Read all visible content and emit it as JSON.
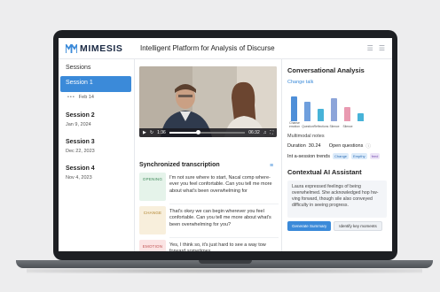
{
  "app": {
    "logo_text": "MIMESIS",
    "title": "Intelligent Platform for Analysis of Discurse"
  },
  "sidebar": {
    "title": "Sessions",
    "active_session": {
      "label": "Session 1",
      "date": "Feb 14"
    },
    "sessions": [
      {
        "label": "Session 2",
        "date": "Jan 9, 2024"
      },
      {
        "label": "Session 3",
        "date": "Dec 22, 2023"
      },
      {
        "label": "Session 4",
        "date": "Nov 4, 2023"
      }
    ]
  },
  "video": {
    "time_current": "1:36",
    "time_total": "06:32",
    "progress_fraction": 0.38
  },
  "transcription": {
    "title": "Synchronized transcription",
    "entries": [
      {
        "tag": "OPENING",
        "tag_bg": "#e5f3ea",
        "tag_color": "#3f8a5a",
        "text": "I'm not sure where to start, Nacal comp where- ever you feel confortable. Can you tell me more about what's been overwhelming for"
      },
      {
        "tag": "CHANGE",
        "tag_bg": "#f8efdc",
        "tag_color": "#b0832d",
        "text": "That's okey we can begin wherever you feel confortable. Can you tell me more about what's been overwhelming for you?"
      },
      {
        "tag": "EMOTION",
        "tag_bg": "#fbe4e4",
        "tag_color": "#c25454",
        "text": "Yes, I think so, it's just hard to see a way tow forward sometimes."
      }
    ]
  },
  "analysis": {
    "title": "Conversational Analysis",
    "subtitle": "Change talk"
  },
  "chart_data": {
    "type": "bar",
    "categories": [
      "Chanse emotion",
      "Question",
      "Reflections",
      "Silence",
      "Silence"
    ],
    "values": [
      78,
      60,
      40,
      73,
      45,
      24
    ],
    "colors": [
      "#4f8fd8",
      "#6f9fdd",
      "#47b3d8",
      "#8da5d9",
      "#e99ab1",
      "#47b3d8"
    ],
    "ylim": [
      0,
      100
    ]
  },
  "multimodal": {
    "title": "Multimodal notes",
    "duration_label": "Duration",
    "duration_value": "30.24",
    "questions_label": "Open questions",
    "intervals_label": "Int a-session trends",
    "badges": [
      {
        "label": "Change",
        "bg": "#dcebfa",
        "color": "#2f6fb5"
      },
      {
        "label": "Empthy",
        "bg": "#dcebfa",
        "color": "#2f6fb5"
      },
      {
        "label": "feed",
        "bg": "#ece4f7",
        "color": "#7a52b3"
      }
    ]
  },
  "assistant": {
    "title": "Contextual AI Assistant",
    "text": "Laura expressed feelings of being overwhelmed. She acknowledged hop hw-ving forward, though sile also conveyed difficulty in seeing progress.",
    "primary_button": "Generate Summary",
    "secondary_button": "Identify key moments"
  }
}
